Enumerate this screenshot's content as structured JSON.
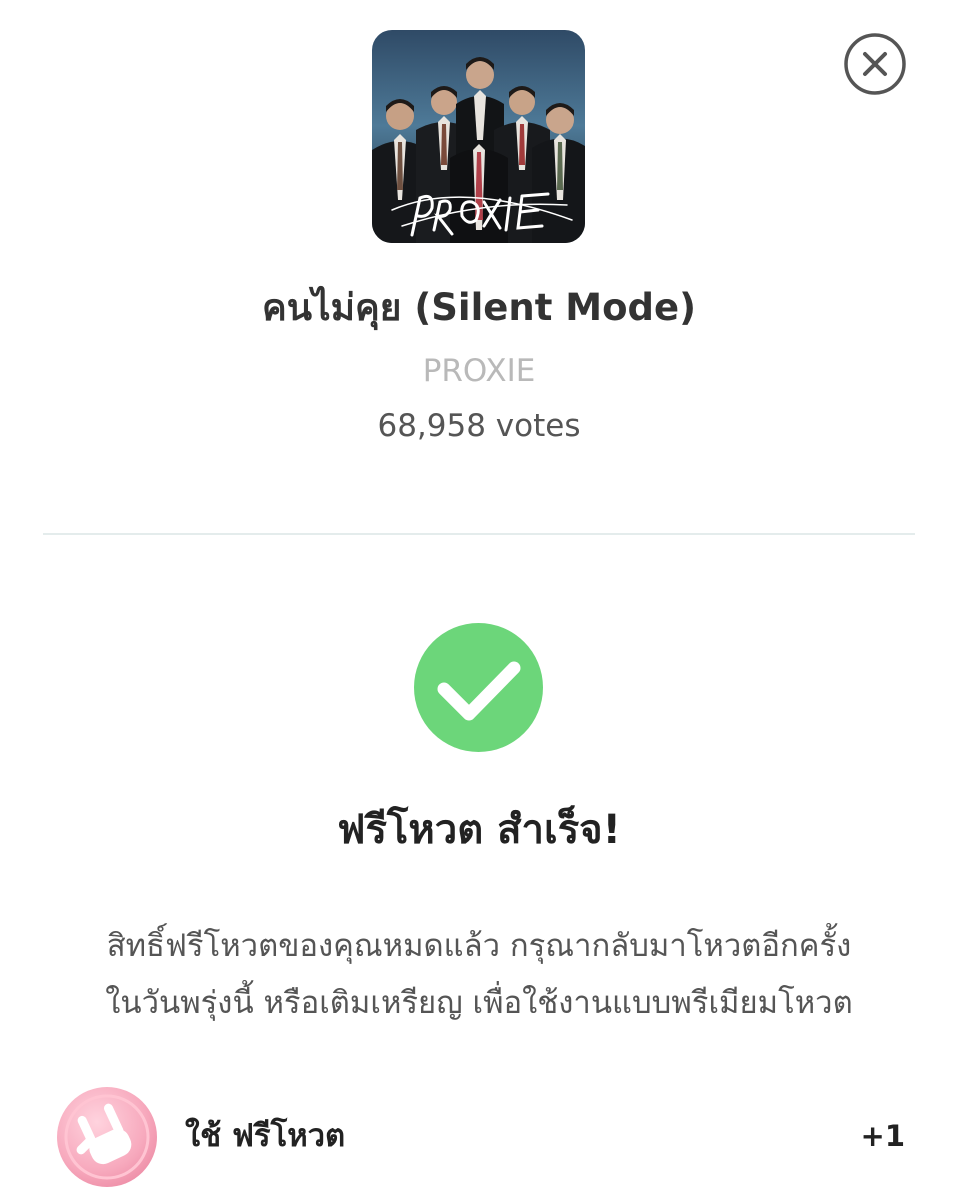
{
  "song": {
    "title": "คนไม่คุย (Silent Mode)",
    "artist": "PROXIE",
    "votes": "68,958 votes",
    "cover_logo_text": "PROXIE"
  },
  "result": {
    "title": "ฟรีโหวต สำเร็จ!",
    "message_line1": "สิทธิ์ฟรีโหวตของคุณหมดแล้ว กรุณากลับมาโหวตอีกครั้ง",
    "message_line2": "ในวันพรุ่งนี้ หรือเติมเหรียญ เพื่อใช้งานแบบพรีเมียมโหวต"
  },
  "vote_option": {
    "label": "ใช้  ฟรีโหวต",
    "count": "+1",
    "icon": "pink-rock-hand-coin-icon"
  },
  "icons": {
    "close": "close-icon",
    "success": "check-circle-icon"
  },
  "colors": {
    "success_green": "#6cd67a",
    "divider": "#e4ecec",
    "artist_gray": "#b9b9b9",
    "coin_pink": "#f7a9bd"
  }
}
